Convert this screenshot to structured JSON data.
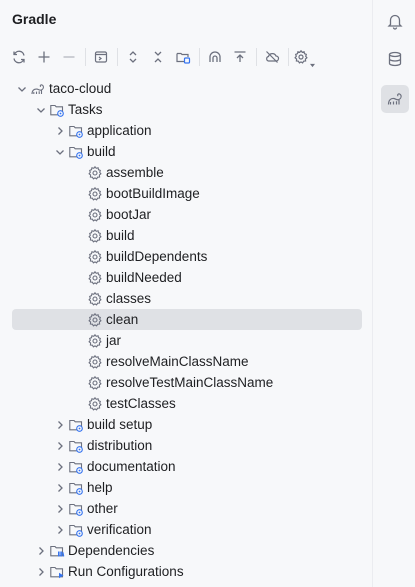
{
  "panel": {
    "title": "Gradle"
  },
  "toolbar": {
    "buttons": [
      "refresh-icon",
      "add-icon",
      "remove-icon",
      "run-config-icon",
      "expand-all-icon",
      "collapse-all-icon",
      "analyze-icon",
      "dependencies-icon",
      "toggle-offline-icon",
      "settings-icon"
    ]
  },
  "tree": {
    "root": "taco-cloud",
    "tasks": "Tasks",
    "groups": {
      "application": "application",
      "build": "build",
      "build_setup": "build setup",
      "distribution": "distribution",
      "documentation": "documentation",
      "help": "help",
      "other": "other",
      "verification": "verification"
    },
    "build_tasks": [
      "assemble",
      "bootBuildImage",
      "bootJar",
      "build",
      "buildDependents",
      "buildNeeded",
      "classes",
      "clean",
      "jar",
      "resolveMainClassName",
      "resolveTestMainClassName",
      "testClasses"
    ],
    "selected_task": "clean",
    "dependencies": "Dependencies",
    "run_configurations": "Run Configurations"
  },
  "rightbar": {
    "items": [
      "notifications-icon",
      "database-icon",
      "gradle-icon"
    ],
    "active": "gradle-icon"
  },
  "colors": {
    "background": "#f7f8fa",
    "selection": "#dfe1e5",
    "icon": "#6c707e",
    "folder_badge": "#3574f0"
  }
}
